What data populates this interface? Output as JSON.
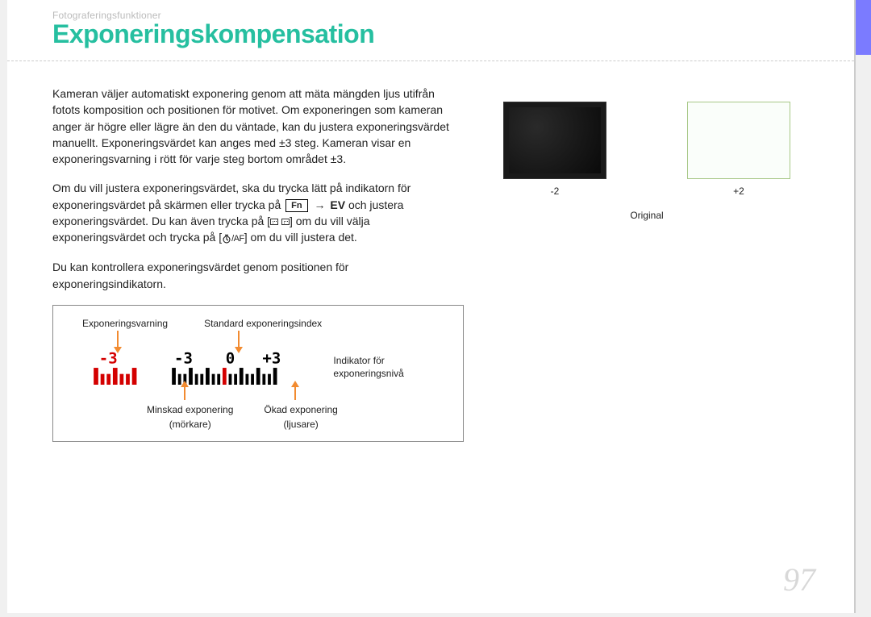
{
  "breadcrumb": "Fotograferingsfunktioner",
  "title": "Exponeringskompensation",
  "para1": "Kameran väljer automatiskt exponering genom att mäta mängden ljus utifrån fotots komposition och positionen för motivet. Om exponeringen som kameran anger är högre eller lägre än den du väntade, kan du justera exponeringsvärdet manuellt. Exponeringsvärdet kan anges med ±3 steg. Kameran visar en exponeringsvarning i rött för varje steg bortom området ±3.",
  "para2a": "Om du vill justera exponeringsvärdet, ska du trycka lätt på indikatorn för exponeringsvärdet på skärmen eller trycka på ",
  "fn_label": "Fn",
  "arrow": "→",
  "ev_label": "EV",
  "para2b": " och justera exponeringsvärdet. Du kan även trycka på [",
  "para2c": "] om du vill välja exponeringsvärdet och trycka på [",
  "af_text": "/AF",
  "para2d": "] om du vill justera det.",
  "para3": "Du kan kontrollera exponeringsvärdet genom positionen för exponeringsindikatorn.",
  "diagram": {
    "label_warning": "Exponeringsvarning",
    "label_standard": "Standard exponeringsindex",
    "label_indicator": "Indikator för exponeringsnivå",
    "label_decrease": "Minskad exponering",
    "label_decrease2": "(mörkare)",
    "label_increase": "Ökad exponering",
    "label_increase2": "(ljusare)",
    "scale": {
      "min": -3,
      "center": 0,
      "max": 3
    }
  },
  "thumbs": {
    "left": "-2",
    "right": "+2",
    "original": "Original"
  },
  "page_number": "97"
}
